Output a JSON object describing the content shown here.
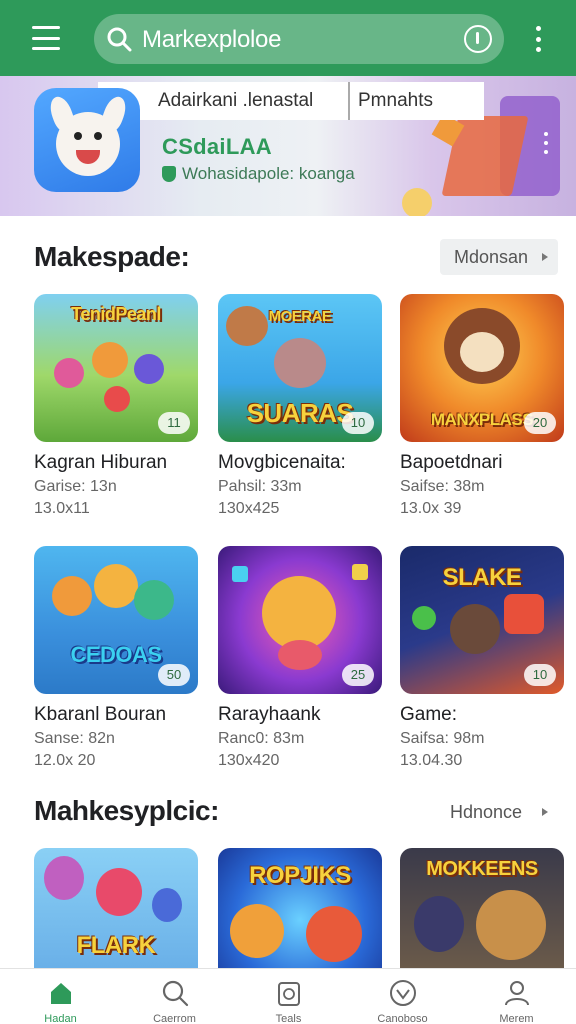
{
  "header": {
    "search_text": "Markexploloe",
    "icons": [
      "menu-icon",
      "search-icon",
      "mic-icon",
      "more-vert-icon"
    ]
  },
  "banner": {
    "tab1": "Adairkani .lenastal",
    "tab2": "Pmnahts",
    "app_name": "CSdaiLAA",
    "app_sub": "Wohasidapole: koanga"
  },
  "section1": {
    "title": "Makespade:",
    "more": "Mdonsan",
    "cards": [
      {
        "name": "Kagran Hiburan",
        "meta": "Garise: 13n",
        "date": "13.0x11",
        "thumb_title": "TenidPeanl",
        "badge": "11"
      },
      {
        "name": "Movgbicenaita:",
        "meta": "Pahsil: 33m",
        "date": "130x425",
        "thumb_title": "SUARAS",
        "badge": "10"
      },
      {
        "name": "Bapoetdnari",
        "meta": "Saifse: 38m",
        "date": "13.0x 39",
        "thumb_title": "MANXPLASS",
        "badge": "20"
      },
      {
        "name": "Kbaranl Bouran",
        "meta": "Sanse: 82n",
        "date": "12.0x 20",
        "thumb_title": "CEDOAS",
        "badge": "50"
      },
      {
        "name": "Rarayhaank",
        "meta": "Ranc0: 83m",
        "date": "130x420",
        "thumb_title": "",
        "badge": "25"
      },
      {
        "name": "Game:",
        "meta": "Saifsa: 98m",
        "date": "13.04.30",
        "thumb_title": "SLAKE",
        "badge": "10"
      }
    ]
  },
  "section2": {
    "title": "Mahkesyplcic:",
    "more": "Hdnonce",
    "cards": [
      {
        "thumb_title": "FLARK"
      },
      {
        "thumb_title": "ROPJIKS"
      },
      {
        "thumb_title": "MOKKEENS"
      }
    ]
  },
  "bottom_nav": [
    {
      "label": "Hadan",
      "icon": "home-icon",
      "active": true
    },
    {
      "label": "Caerrom",
      "icon": "search-icon",
      "active": false
    },
    {
      "label": "Teals",
      "icon": "games-icon",
      "active": false
    },
    {
      "label": "Canoboso",
      "icon": "heart-icon",
      "active": false
    },
    {
      "label": "Merem",
      "icon": "profile-icon",
      "active": false
    }
  ],
  "colors": {
    "primary": "#2e9a5a",
    "text": "#202124",
    "muted": "#666666"
  }
}
